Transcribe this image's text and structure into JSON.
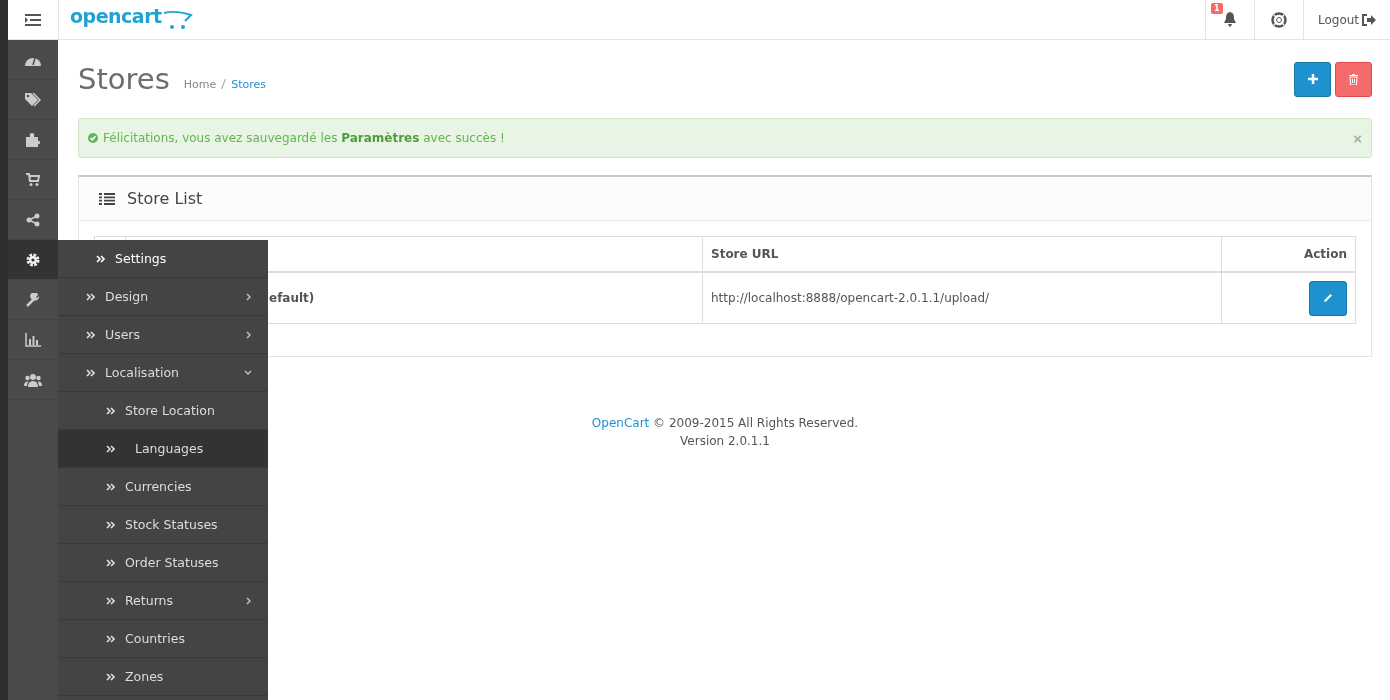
{
  "header": {
    "logo": "opencart",
    "notification_count": "1",
    "logout": "Logout"
  },
  "sidebar": {
    "icons": [
      {
        "kind": "dashboard",
        "selected": false
      },
      {
        "kind": "tags",
        "selected": false
      },
      {
        "kind": "puzzle",
        "selected": false
      },
      {
        "kind": "cart",
        "selected": false
      },
      {
        "kind": "share",
        "selected": false
      },
      {
        "kind": "gear",
        "selected": true
      },
      {
        "kind": "wrench",
        "selected": false
      },
      {
        "kind": "chart",
        "selected": false
      },
      {
        "kind": "users",
        "selected": false
      }
    ]
  },
  "flyout_menu": {
    "items": [
      {
        "label": "Settings",
        "hover": true,
        "selected": false
      },
      {
        "label": "Design",
        "hover": false,
        "selected": false,
        "expanded": false
      },
      {
        "label": "Users",
        "hover": false,
        "selected": false,
        "expanded": false
      },
      {
        "label": "Localisation",
        "hover": false,
        "selected": false,
        "expanded": true,
        "children": [
          {
            "label": "Store Location",
            "selected": false
          },
          {
            "label": "Languages",
            "selected": true
          },
          {
            "label": "Currencies",
            "selected": false
          },
          {
            "label": "Stock Statuses",
            "selected": false
          },
          {
            "label": "Order Statuses",
            "selected": false
          },
          {
            "label": "Returns",
            "selected": false,
            "expanded": false
          },
          {
            "label": "Countries",
            "selected": false
          },
          {
            "label": "Zones",
            "selected": false
          }
        ]
      }
    ]
  },
  "page": {
    "title": "Stores",
    "breadcrumb": [
      {
        "label": "Home",
        "selected": false
      },
      {
        "label": "Stores",
        "selected": true
      }
    ]
  },
  "alert": {
    "text": "Félicitations, vous avez sauvegardé les **Paramètres** avec succès !",
    "close": "×"
  },
  "panel": {
    "title": "Store List",
    "table": {
      "columns": [
        "Store URL",
        "Action"
      ],
      "rows": [
        {
          "store_name": "efault)",
          "store_url": "http://localhost:8888/opencart-2.0.1.1/upload/"
        }
      ]
    }
  },
  "footer": {
    "link": "OpenCart",
    "copyright": "© 2009-2015 All Rights Reserved.",
    "version": "Version 2.0.1.1"
  }
}
